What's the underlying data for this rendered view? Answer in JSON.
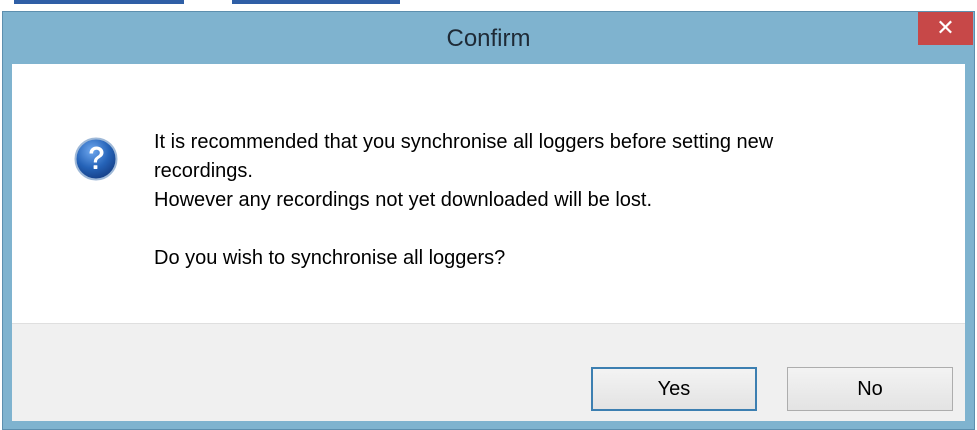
{
  "dialog": {
    "title": "Confirm",
    "close_symbol": "✕",
    "icon": "question-icon",
    "message_lines": [
      "It is recommended that you synchronise all loggers before setting new",
      "recordings.",
      "However any recordings not yet downloaded will be lost.",
      "",
      "Do you wish to synchronise all loggers?"
    ],
    "buttons": {
      "yes_label": "Yes",
      "no_label": "No"
    }
  },
  "colors": {
    "titlebar": "#7fb3cf",
    "close_button": "#c74848",
    "icon_blue": "#2563b8",
    "default_button_border": "#3c7fb1"
  }
}
